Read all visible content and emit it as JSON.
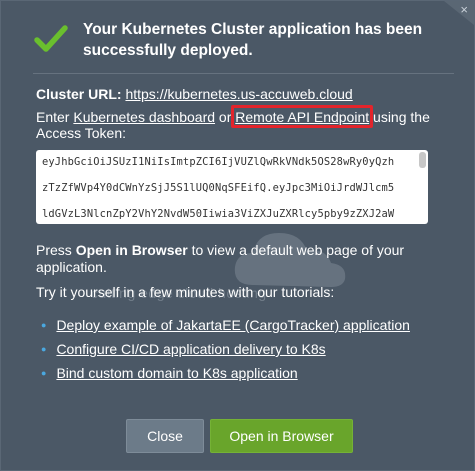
{
  "dialog": {
    "title": "Your Kubernetes Cluster application has been successfully deployed.",
    "close_glyph": "×",
    "cluster_url_label": "Cluster URL:",
    "cluster_url": "https://kubernetes.us-accuweb.cloud",
    "enter_prefix": "Enter",
    "dashboard_link": "Kubernetes dashboard",
    "or_text": "or",
    "remote_api_link": "Remote API Endpoint",
    "enter_suffix": "using the Access Token:",
    "token_lines": [
      "eyJhbGciOiJSUzI1NiIsImtpZCI6IjVUZlQwRkVNdk5OS28wRy0yQzh",
      "zTzZfWVp4Y0dCWnYzSjJ5S1lUQ0NqSFEifQ.eyJpc3MiOiJrdWJlcm5",
      "ldGVzL3NlcnZpY2VhY2NvdW50Iiwia3ViZXJuZXRlcy5pby9zZXJ2aW"
    ],
    "press_prefix": "Press",
    "press_bold": "Open in Browser",
    "press_suffix": "to view a default web page of your application.",
    "try_text": "Try it yourself in a few minutes with our tutorials:",
    "watermark_text": "cutting edge cloud hosting",
    "tutorials": [
      "Deploy example of JakartaEE (CargoTracker) application",
      "Configure CI/CD application delivery to K8s",
      "Bind custom domain to K8s application"
    ],
    "buttons": {
      "close": "Close",
      "open": "Open in Browser"
    }
  },
  "colors": {
    "dialog_bg": "#4b5866",
    "success_green": "#6abf2e",
    "open_button": "#69a52b",
    "close_button": "#6c7b89",
    "highlight_box": "#e3242b",
    "bullet_blue": "#4aa8e0"
  },
  "icons": {
    "success": "check-icon",
    "corner_close": "close-icon",
    "bullet": "bullet-icon"
  }
}
